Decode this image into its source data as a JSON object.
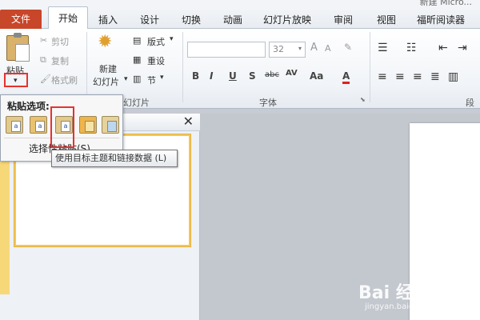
{
  "window": {
    "title": "新建 Micro..."
  },
  "tabs": [
    {
      "label": "文件"
    },
    {
      "label": "开始"
    },
    {
      "label": "插入"
    },
    {
      "label": "设计"
    },
    {
      "label": "切换"
    },
    {
      "label": "动画"
    },
    {
      "label": "幻灯片放映"
    },
    {
      "label": "审阅"
    },
    {
      "label": "视图"
    },
    {
      "label": "福昕阅读器"
    }
  ],
  "clipboard": {
    "paste": "粘贴",
    "cut": "剪切",
    "copy": "复制",
    "format_painter": "格式刷"
  },
  "slides": {
    "new_slide_1": "新建",
    "new_slide_2": "幻灯片",
    "layout": "版式",
    "reset": "重设",
    "section": "节",
    "group_label": "幻灯片"
  },
  "font": {
    "size": "32",
    "group_label": "字体",
    "bold": "B",
    "italic": "I",
    "underline": "U",
    "shadow": "S",
    "strike": "abc",
    "spacing": "AV",
    "case": "Aa",
    "color": "A"
  },
  "paragraph": {
    "group_label": "段"
  },
  "paste_options": {
    "title": "粘贴选项:",
    "select_label": "选择性粘贴(S)...",
    "icon_letter": "a"
  },
  "tooltip": {
    "text": "使用目标主题和链接数据 (L)"
  },
  "pane": {
    "close": "✕"
  },
  "watermark": {
    "brand": "Bai 经验",
    "url": "jingyan.baidu.com"
  },
  "colors": {
    "file_tab": "#c8462a",
    "highlight": "#e6322e"
  }
}
